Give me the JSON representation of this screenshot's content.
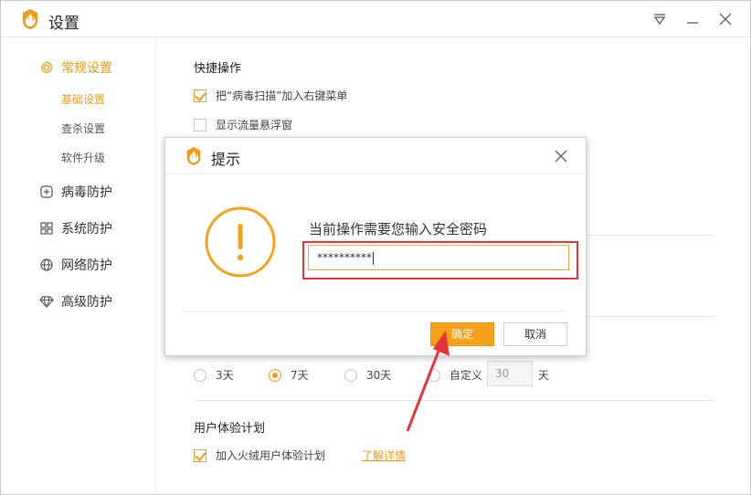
{
  "window": {
    "title": "设置"
  },
  "sidebar": {
    "items": [
      {
        "label": "常规设置",
        "icon": "gear-icon"
      },
      {
        "label": "病毒防护",
        "icon": "plus-square-icon"
      },
      {
        "label": "系统防护",
        "icon": "windows-grid-icon"
      },
      {
        "label": "网络防护",
        "icon": "globe-icon"
      },
      {
        "label": "高级防护",
        "icon": "diamond-icon"
      }
    ],
    "subitems": [
      {
        "label": "基础设置"
      },
      {
        "label": "查杀设置"
      },
      {
        "label": "软件升级"
      }
    ]
  },
  "content": {
    "shortcut": {
      "title": "快捷操作",
      "options": [
        {
          "label": "把“病毒扫描”加入右键菜单",
          "checked": true
        },
        {
          "label": "显示流量悬浮窗",
          "checked": false
        }
      ]
    },
    "days": {
      "options": [
        {
          "label": "3天",
          "checked": false
        },
        {
          "label": "7天",
          "checked": true
        },
        {
          "label": "30天",
          "checked": false
        },
        {
          "label": "自定义",
          "checked": false
        }
      ],
      "custom_value": "30",
      "unit": "天"
    },
    "ux_plan": {
      "title": "用户体验计划",
      "option": {
        "label": "加入火绒用户体验计划",
        "checked": true
      },
      "link": "了解详情"
    }
  },
  "dialog": {
    "title": "提示",
    "prompt": "当前操作需要您输入安全密码",
    "password_value": "**********",
    "ok_label": "确定",
    "cancel_label": "取消"
  },
  "colors": {
    "accent": "#f29a19",
    "highlight": "#e8333d",
    "ok_button": "#f7a11a"
  }
}
